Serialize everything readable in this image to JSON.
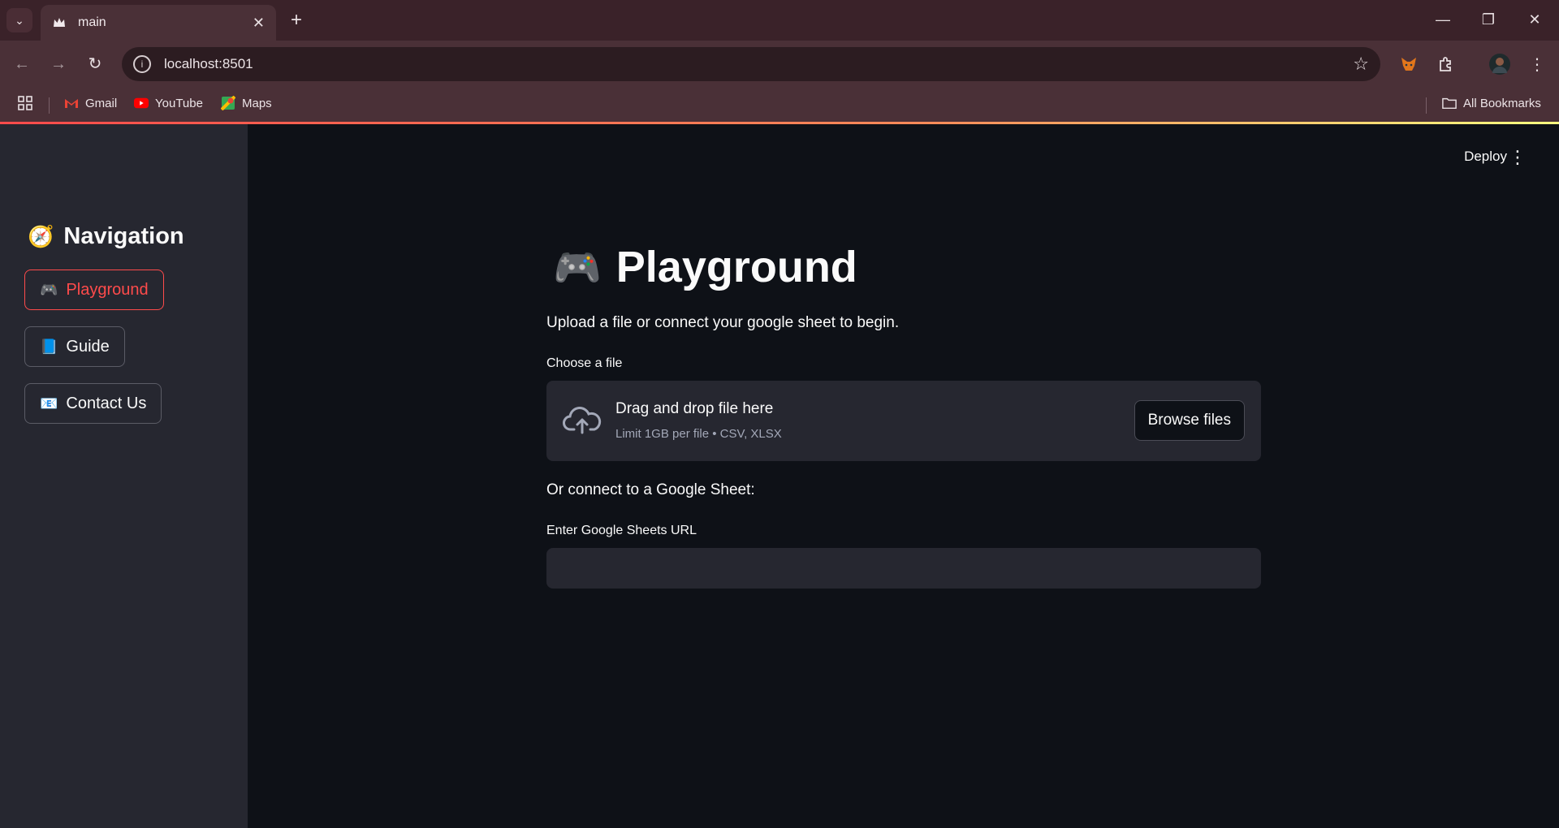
{
  "browser": {
    "tab_title": "main",
    "url": "localhost:8501",
    "bookmarks": [
      {
        "label": "Gmail",
        "icon": "gmail-icon"
      },
      {
        "label": "YouTube",
        "icon": "youtube-icon"
      },
      {
        "label": "Maps",
        "icon": "maps-icon"
      }
    ],
    "all_bookmarks_label": "All Bookmarks"
  },
  "sidebar": {
    "title": "Navigation",
    "title_emoji": "🧭",
    "items": [
      {
        "emoji": "🎮",
        "label": "Playground",
        "active": true
      },
      {
        "emoji": "📘",
        "label": "Guide",
        "active": false
      },
      {
        "emoji": "📧",
        "label": "Contact Us",
        "active": false
      }
    ]
  },
  "header": {
    "deploy_label": "Deploy",
    "menu_icon": "kebab-menu-icon"
  },
  "main": {
    "title_emoji": "🎮",
    "title": "Playground",
    "intro": "Upload a file or connect your google sheet to begin.",
    "file_label": "Choose a file",
    "drop_text": "Drag and drop file here",
    "drop_sub": "Limit 1GB per file • CSV, XLSX",
    "browse_label": "Browse files",
    "or_text": "Or connect to a Google Sheet:",
    "sheets_label": "Enter Google Sheets URL",
    "sheets_value": ""
  },
  "colors": {
    "accent": "#ff4b4b",
    "sidebar_bg": "#262730",
    "main_bg": "#0e1117",
    "chrome_bg": "#4a3037"
  }
}
